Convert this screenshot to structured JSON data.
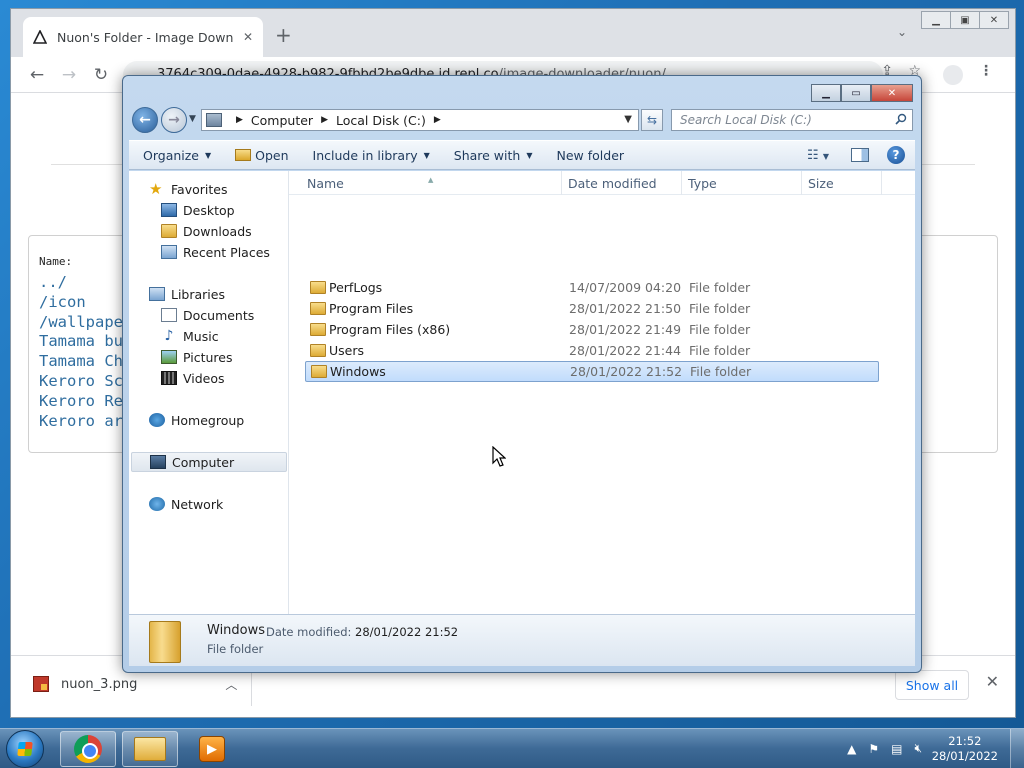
{
  "browser": {
    "tab_title": "Nuon's Folder - Image Downloac",
    "tab_close": "✕",
    "new_tab": "+",
    "url_host": "3764c309-0dae-4928-b982-9fbbd2be9dbe.id.repl.co",
    "url_path": "/image-downloader/nuon/"
  },
  "page": {
    "name_label": "Name:",
    "files": [
      "../",
      "/icon",
      "/wallpape",
      "Tamama bu",
      "Tamama Ch",
      "Keroro Sc",
      "Keroro Re",
      "Keroro ar"
    ]
  },
  "downloads": {
    "file_name": "nuon_3.png",
    "show_all": "Show all"
  },
  "explorer": {
    "breadcrumb": [
      "Computer",
      "Local Disk (C:)"
    ],
    "search_placeholder": "Search Local Disk (C:)",
    "toolbar": {
      "organize": "Organize",
      "open": "Open",
      "include_in_library": "Include in library",
      "share_with": "Share with",
      "new_folder": "New folder"
    },
    "nav": {
      "favorites": "Favorites",
      "desktop": "Desktop",
      "downloads": "Downloads",
      "recent_places": "Recent Places",
      "libraries": "Libraries",
      "documents": "Documents",
      "music": "Music",
      "pictures": "Pictures",
      "videos": "Videos",
      "homegroup": "Homegroup",
      "computer": "Computer",
      "network": "Network"
    },
    "columns": {
      "name": "Name",
      "date_modified": "Date modified",
      "type": "Type",
      "size": "Size"
    },
    "rows": [
      {
        "name": "PerfLogs",
        "date": "14/07/2009 04:20",
        "type": "File folder"
      },
      {
        "name": "Program Files",
        "date": "28/01/2022 21:50",
        "type": "File folder"
      },
      {
        "name": "Program Files (x86)",
        "date": "28/01/2022 21:49",
        "type": "File folder"
      },
      {
        "name": "Users",
        "date": "28/01/2022 21:44",
        "type": "File folder"
      },
      {
        "name": "Windows",
        "date": "28/01/2022 21:52",
        "type": "File folder"
      }
    ],
    "details": {
      "name": "Windows",
      "modified_label": "Date modified:",
      "modified_value": "28/01/2022 21:52",
      "type": "File folder"
    }
  },
  "taskbar": {
    "time": "21:52",
    "date": "28/01/2022"
  }
}
